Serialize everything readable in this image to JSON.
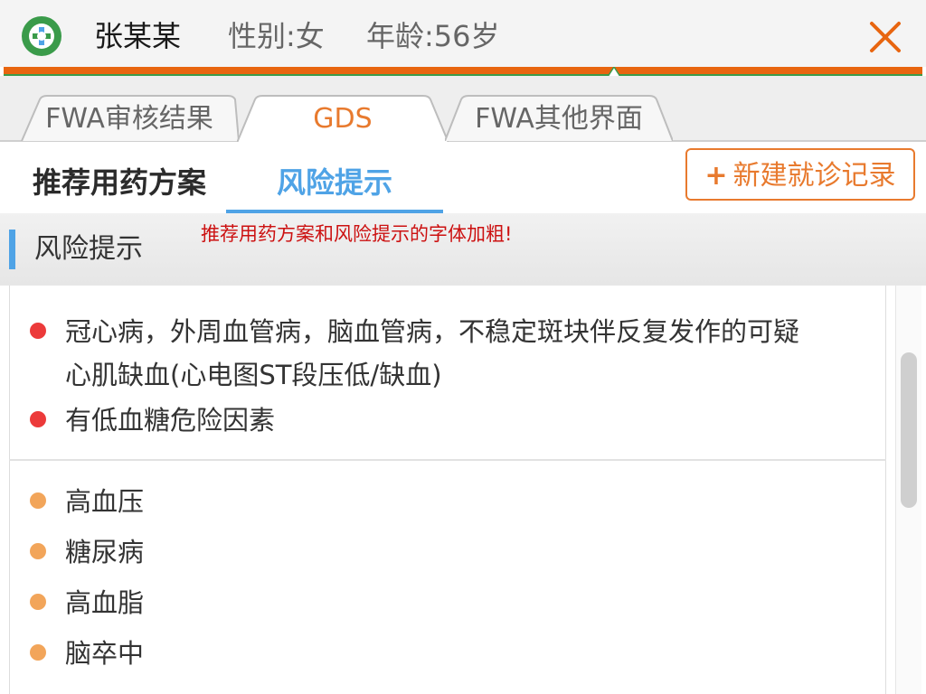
{
  "header": {
    "patient_name": "张某某",
    "gender": "性别:女",
    "age": "年龄:56岁"
  },
  "top_tabs": [
    {
      "label": "FWA审核结果",
      "active": false
    },
    {
      "label": "GDS",
      "active": true
    },
    {
      "label": "FWA其他界面",
      "active": false
    }
  ],
  "sub_tabs": [
    {
      "label": "推荐用药方案",
      "active": false
    },
    {
      "label": "风险提示",
      "active": true
    }
  ],
  "new_visit_button": {
    "icon": "+",
    "label": "新建就诊记录"
  },
  "section": {
    "title": "风险提示",
    "annotation": "推荐用药方案和风险提示的字体加粗!"
  },
  "high_risk_items": [
    {
      "line1": "冠心病，外周血管病，脑血管病，不稳定斑块伴反复发作的可疑",
      "line2": "心肌缺血(心电图ST段压低/缺血)"
    },
    {
      "line1": "有低血糖危险因素"
    }
  ],
  "medium_risk_items": [
    "高血压",
    "糖尿病",
    "高血脂",
    "脑卒中"
  ],
  "colors": {
    "accent_orange": "#e87a2e",
    "active_blue": "#4fa3e6",
    "high_risk": "#ec3a3a",
    "medium_risk": "#f2a55a",
    "annotation_red": "#cc1111"
  }
}
